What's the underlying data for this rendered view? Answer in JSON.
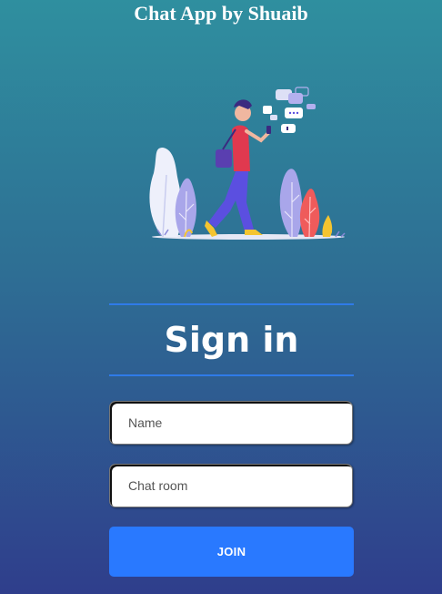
{
  "app": {
    "title": "Chat App by Shuaib"
  },
  "signin": {
    "heading": "Sign in",
    "name_placeholder": "Name",
    "room_placeholder": "Chat room",
    "join_label": "JOIN"
  },
  "colors": {
    "accent": "#2979ff",
    "divider": "#2f7be8",
    "background_top": "#2f8f9f",
    "background_bottom": "#2f3e8c"
  },
  "illustration": {
    "name": "person-texting-with-chat-bubbles-illustration"
  }
}
